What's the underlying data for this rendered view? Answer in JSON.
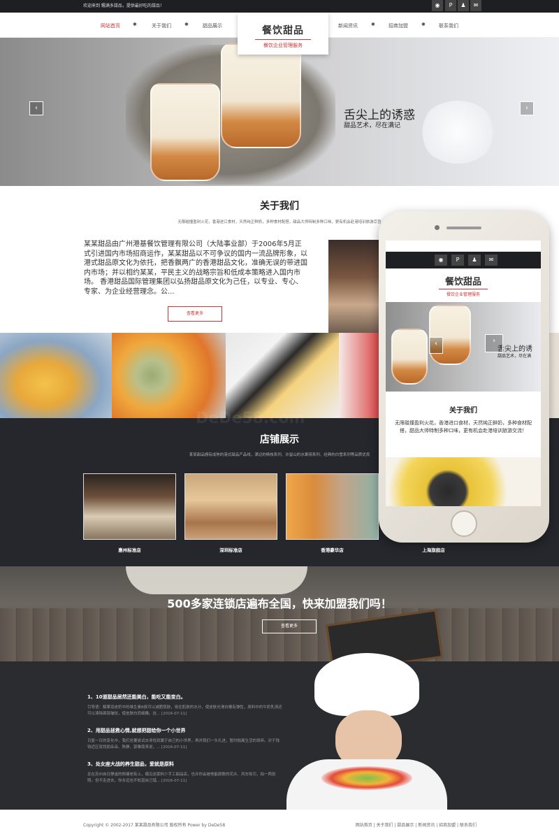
{
  "topbar": {
    "welcome": "欢迎来到 糯满多甜品，提供最好吃的甜品！",
    "social_icons": [
      "weibo-icon",
      "pinterest-icon",
      "qq-icon",
      "mail-icon"
    ]
  },
  "nav": {
    "left": [
      "网站首页",
      "关于我们",
      "甜品展示"
    ],
    "right": [
      "新闻资讯",
      "招商加盟",
      "联系我们"
    ],
    "active_color": "#cc3333"
  },
  "logo": {
    "title": "餐饮甜品",
    "subtitle": "餐饮企业管理服务"
  },
  "banner": {
    "slogan1": "舌尖上的诱惑",
    "slogan2": "甜品艺术，尽在满记",
    "prev": "‹",
    "next": "›"
  },
  "about": {
    "title": "关于我们",
    "subtitle": "无限碰撞盈利火花，香港进口食材，天然纯正鲜奶，多种食材配搭，甜品大师特制多种口味，更有机会赴港培训旅游宗旨",
    "text": "某某甜品由广州港基餐饮管理有限公司（大陆事业部）于2006年5月正式引进国内市场招商运作，某某甜品以不可争议的国内一流品牌形象，以港式甜品原文化为依托，把香飘两广的香港甜品文化，准确无误的带进国内市场；并以相约某某，平民主义的战略宗旨和低成本策略进入国内市场。 香港甜品国际管理集团以弘扬甜品原文化为己任，以专业、专心、专家、为企业经营理念。公...",
    "more": "查看更多"
  },
  "shops": {
    "title": "店铺展示",
    "subtitle": "某某甜品拥有成熟的港式甜品产品线，满记的杨枝系列、许留山的水果捞系列、经典的白雪系列等品质优良",
    "stores": [
      "惠州标准店",
      "深圳标准店",
      "香港豪华店",
      "上海旗舰店"
    ]
  },
  "franchise": {
    "text": "500多家连锁店遍布全国，快来加盟我们吗！",
    "more": "查看更多"
  },
  "news": [
    {
      "title": "1、10道甜品居然还能美白，能吃又能变白。",
      "summary": "引导语：解果双皮奶中的维生素B族可以减肥肌肤，吸住肌肤的水分，使皮肤光滑白嫩有弹性，原料中的牛奶乳清还可以清除面部皱纹，使皮肤白而细嫩。这...",
      "date": "[2016-07-11]"
    },
    {
      "title": "2、用甜品拯救心情,就想把甜给你一个小世界",
      "summary": "日复一日的变化中，我们总要尝试去寻找到属于自己的小世界，再并我们一头扎进，暂时抛离生活的琐碎。对于钱钱近区就找朋朵朵、陈静、郭雅南来说，...",
      "date": "[2016-07-11]"
    },
    {
      "title": "3、处女座大战的养生甜品，爱就是原料",
      "summary": "走在苏州自日静谧的斜塘老街上，偶见这家料少手工甜品店，也许你会被他能颜数的花卉、风车吸引，拍一两张照。但不走进去，你永远也不知道自己错...",
      "date": "[2016-07-11]"
    }
  ],
  "footer": {
    "copyright": "Copyright © 2002-2017 某某甜品有限公司 版权所有 Power by DeDe58",
    "links": [
      "网站首页",
      "关于我们",
      "甜品展示",
      "新闻资讯",
      "招商加盟",
      "联系我们"
    ]
  },
  "mobile": {
    "logo_title": "餐饮甜品",
    "logo_subtitle": "餐饮企业管理服务",
    "slogan1": "舌尖上的诱",
    "slogan2": "甜品艺术，尽在满",
    "about_title": "关于我们",
    "about_text": "无限碰撞盈利火花，香港进口食材，天然纯正鲜奶，多种食材配搭，甜品大师特制多种口味，更有机会赴港培训旅游交流！"
  },
  "watermark": "DeDe58.com"
}
